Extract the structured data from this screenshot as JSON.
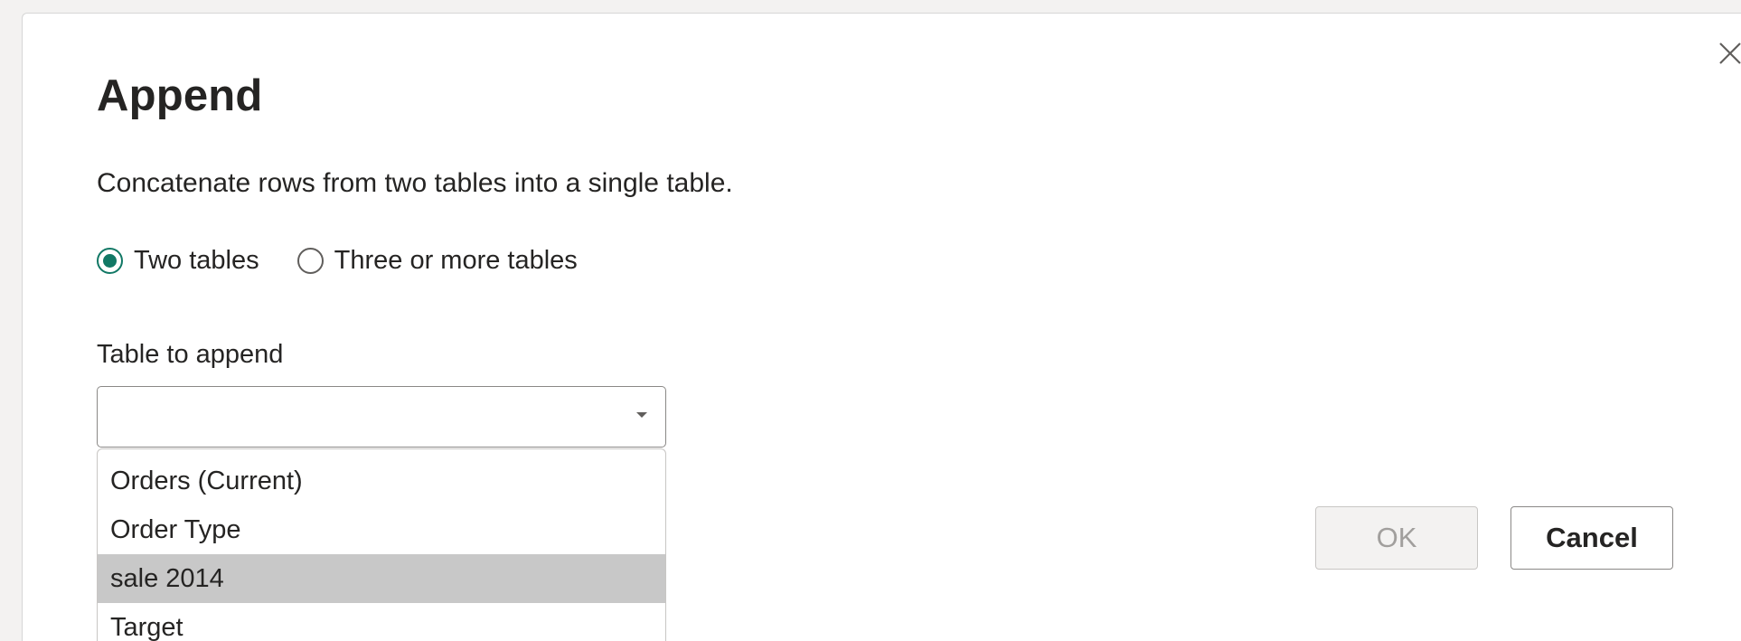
{
  "dialog": {
    "title": "Append",
    "description": "Concatenate rows from two tables into a single table.",
    "close_icon": "close-icon",
    "mode_options": [
      {
        "label": "Two tables",
        "selected": true
      },
      {
        "label": "Three or more tables",
        "selected": false
      }
    ],
    "table_to_append": {
      "label": "Table to append",
      "value": "",
      "options": [
        "Orders (Current)",
        "Order Type",
        "sale 2014",
        "Target"
      ],
      "highlighted_option": "sale 2014"
    },
    "buttons": {
      "ok_label": "OK",
      "ok_enabled": false,
      "cancel_label": "Cancel"
    }
  },
  "colors": {
    "accent": "#117865",
    "highlight": "#c8c8c8",
    "text": "#252423",
    "disabled_text": "#a19f9d"
  }
}
